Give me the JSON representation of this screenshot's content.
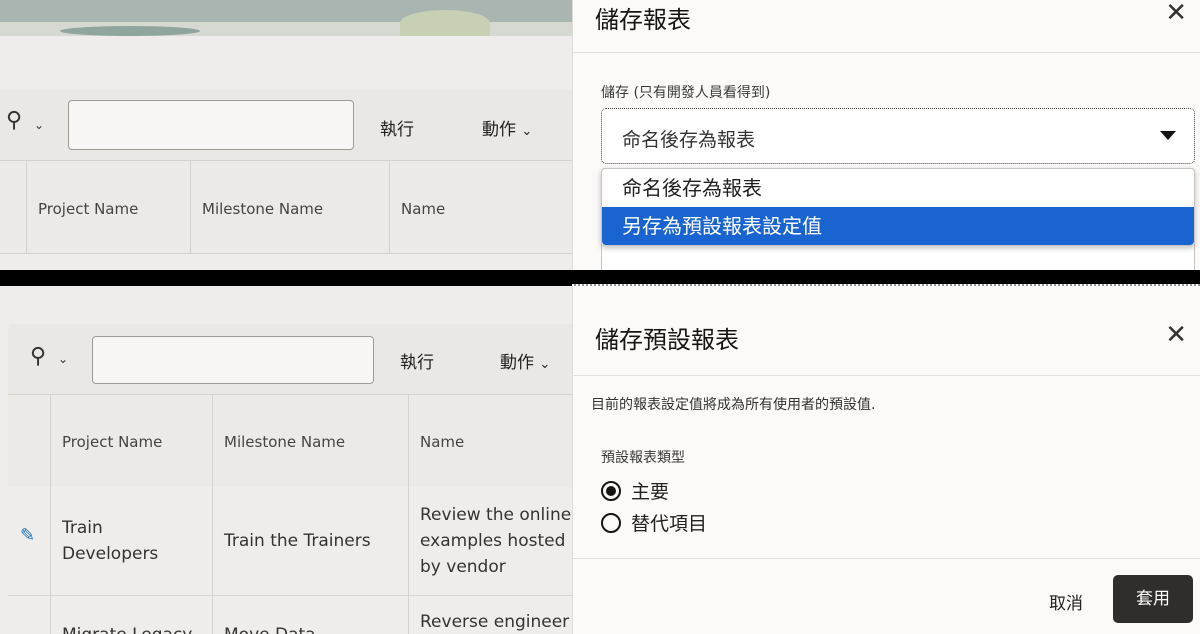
{
  "top": {
    "toolbar": {
      "run_label": "執行",
      "actions_label": "動作"
    },
    "columns": [
      "Project Name",
      "Milestone Name",
      "Name"
    ],
    "dialog": {
      "title": "儲存報表",
      "close_icon": "close-icon",
      "field_label": "儲存 (只有開發人員看得到)",
      "select_value": "命名後存為報表",
      "options": [
        "命名後存為報表",
        "另存為預設報表設定值"
      ],
      "selected_option_index": 1
    }
  },
  "bottom": {
    "toolbar": {
      "run_label": "執行",
      "actions_label": "動作"
    },
    "columns": [
      "Project Name",
      "Milestone Name",
      "Name"
    ],
    "rows": [
      {
        "project": "Train Developers",
        "milestone": "Train the Trainers",
        "name": "Review the online examples hosted by vendor"
      },
      {
        "project": "Migrate Legacy",
        "milestone": "Move Data",
        "name": "Reverse engineer"
      }
    ],
    "dialog": {
      "title": "儲存預設報表",
      "description": "目前的報表設定值將成為所有使用者的預設值.",
      "field_label": "預設報表類型",
      "radio_options": [
        "主要",
        "替代項目"
      ],
      "selected_radio_index": 0,
      "cancel_label": "取消",
      "apply_label": "套用"
    }
  },
  "colors": {
    "accent": "#1a64d2",
    "primary_button": "#312d2a"
  }
}
